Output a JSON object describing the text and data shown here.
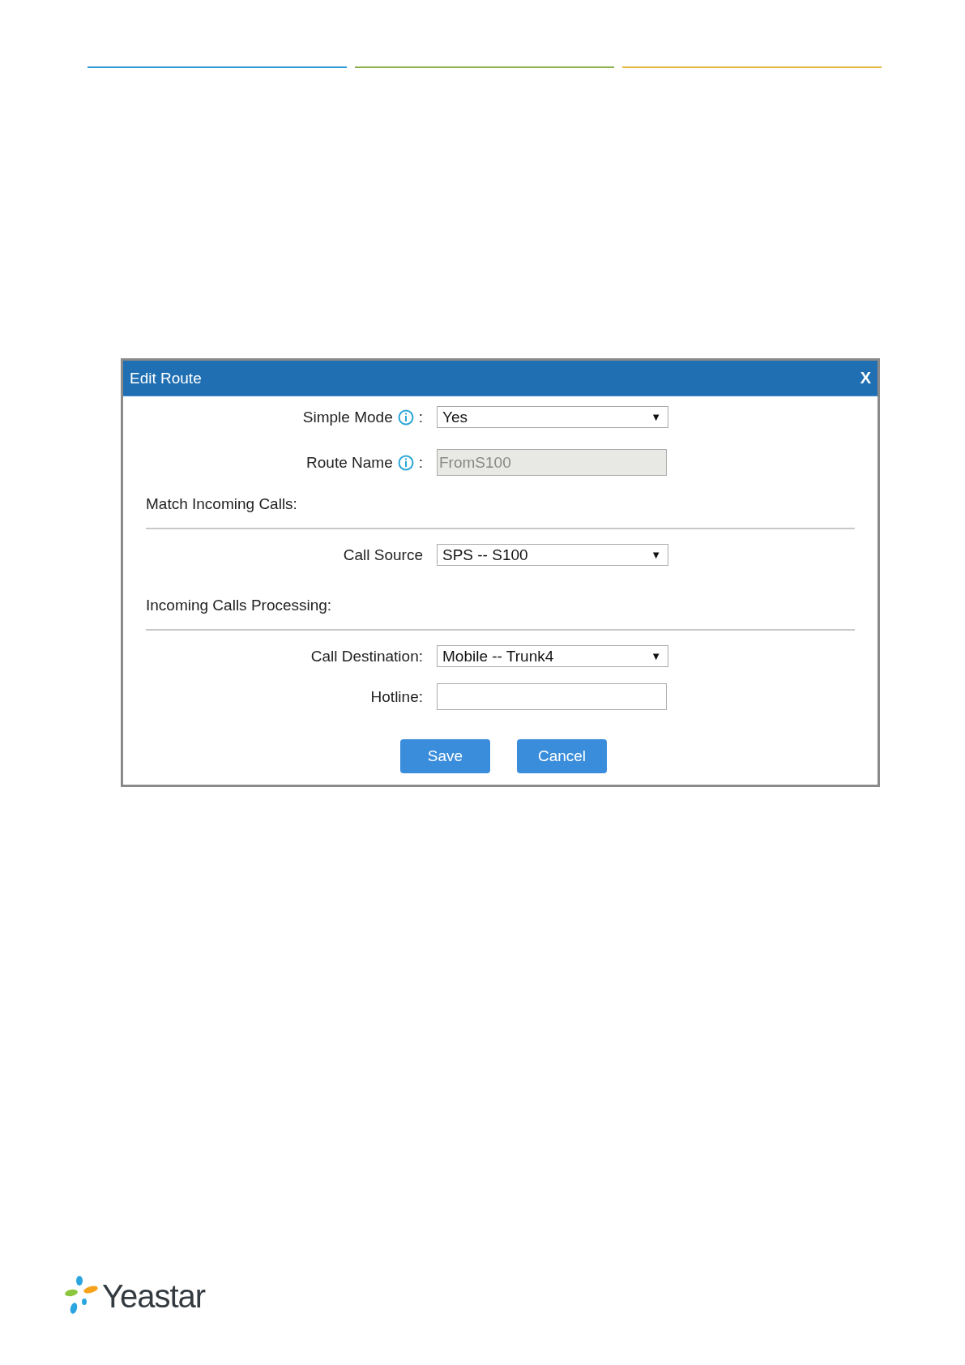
{
  "header_rules": [
    {
      "color": "#2b9ad6"
    },
    {
      "color": "#8bb04a"
    },
    {
      "color": "#e6b93a"
    }
  ],
  "dialog": {
    "title": "Edit Route",
    "close": "X",
    "rows": [
      {
        "kind": "select",
        "label": "Simple Mode",
        "info": true,
        "colon": ":",
        "value": "Yes",
        "caret": "▼"
      },
      {
        "kind": "input",
        "label": "Route Name",
        "info": true,
        "colon": ":",
        "value": "FromS100",
        "disabled": true
      },
      {
        "kind": "heading",
        "label": "Match Incoming Calls:"
      },
      {
        "kind": "select",
        "label": "Call Source",
        "info": false,
        "value": "SPS -- S100",
        "caret": "▼"
      },
      {
        "kind": "heading",
        "label": "Incoming Calls Processing:"
      },
      {
        "kind": "select",
        "label": "Call Destination:",
        "info": false,
        "value": "Mobile -- Trunk4",
        "caret": "▼"
      },
      {
        "kind": "input",
        "label": "Hotline:",
        "info": false,
        "disabled": false
      }
    ],
    "buttons": [
      "Save",
      "Cancel"
    ]
  },
  "logo": {
    "text": "Yeastar"
  }
}
